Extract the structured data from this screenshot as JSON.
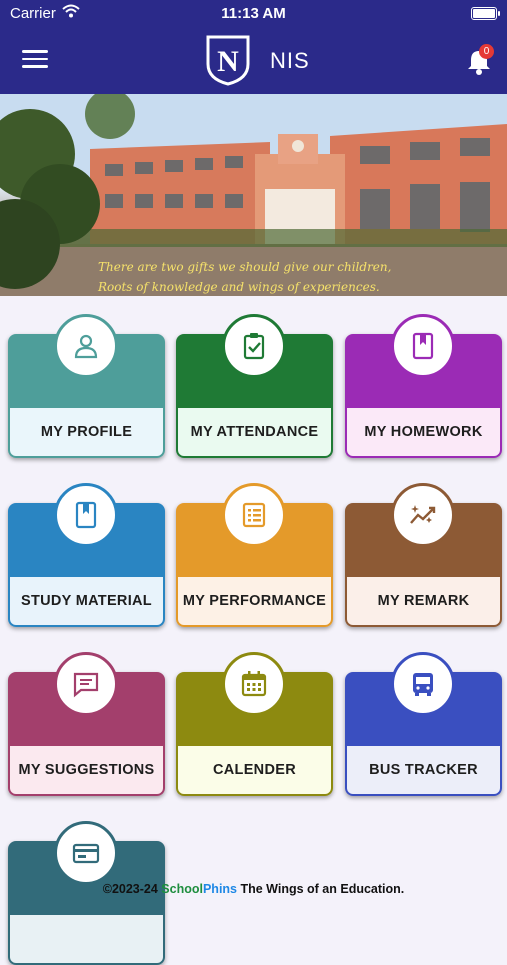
{
  "status_bar": {
    "carrier": "Carrier",
    "time": "11:13 AM"
  },
  "app_bar": {
    "title": "NIS",
    "notification_count": "0"
  },
  "banner": {
    "quote_line1": "There are two gifts we should give our children,",
    "quote_line2": "Roots of knowledge and wings of experiences."
  },
  "tiles": [
    {
      "label": "MY PROFILE",
      "icon": "person-icon",
      "color": "#4e9e9a",
      "light": "#eaf6fb"
    },
    {
      "label": "MY ATTENDANCE",
      "icon": "clipboard-check-icon",
      "color": "#1f7a35",
      "light": "#eafaf0"
    },
    {
      "label": "MY HOMEWORK",
      "icon": "bookmark-book-icon",
      "color": "#9b2bb5",
      "light": "#fbe9f8"
    },
    {
      "label": "STUDY MATERIAL",
      "icon": "bookmark-book-icon",
      "color": "#2a85c2",
      "light": "#e8f3fb"
    },
    {
      "label": "MY PERFORMANCE",
      "icon": "list-icon",
      "color": "#e49a2a",
      "light": "#fdf1e6"
    },
    {
      "label": "MY REMARK",
      "icon": "auto-graph-icon",
      "color": "#8d5a35",
      "light": "#fbefe9"
    },
    {
      "label": "MY SUGGESTIONS",
      "icon": "chat-icon",
      "color": "#a33f6c",
      "light": "#fbe9ef"
    },
    {
      "label": "CALENDER",
      "icon": "calendar-icon",
      "color": "#8d8a10",
      "light": "#fbfde8"
    },
    {
      "label": "BUS TRACKER",
      "icon": "bus-icon",
      "color": "#3a4fc0",
      "light": "#eceef9"
    },
    {
      "label": "",
      "icon": "card-icon",
      "color": "#326b7a",
      "light": "#e8f1f4"
    }
  ],
  "footer": {
    "copyright": "©2023-24 ",
    "brand_a": "School",
    "brand_b": "Phins",
    "tagline": " The Wings of an Education."
  }
}
